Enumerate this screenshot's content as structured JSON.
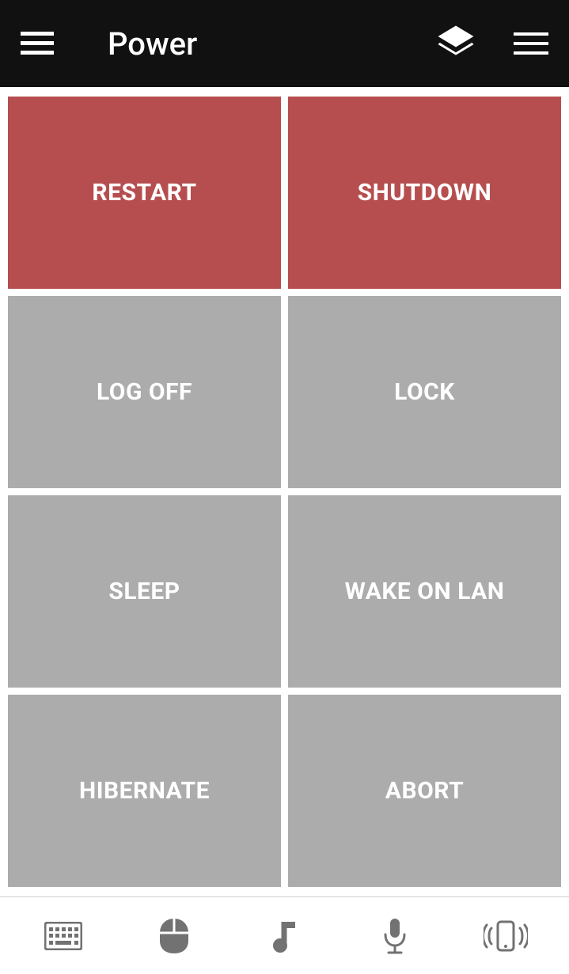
{
  "header": {
    "title": "Power"
  },
  "tiles": [
    {
      "label": "RESTART",
      "style": "danger"
    },
    {
      "label": "SHUTDOWN",
      "style": "danger"
    },
    {
      "label": "LOG OFF",
      "style": "normal"
    },
    {
      "label": "LOCK",
      "style": "normal"
    },
    {
      "label": "SLEEP",
      "style": "normal"
    },
    {
      "label": "WAKE ON LAN",
      "style": "normal"
    },
    {
      "label": "HIBERNATE",
      "style": "normal"
    },
    {
      "label": "ABORT",
      "style": "normal"
    }
  ],
  "colors": {
    "danger": "#b64e4f",
    "normal": "#acacac",
    "topbar": "#111111",
    "bottomIcon": "#727272"
  }
}
